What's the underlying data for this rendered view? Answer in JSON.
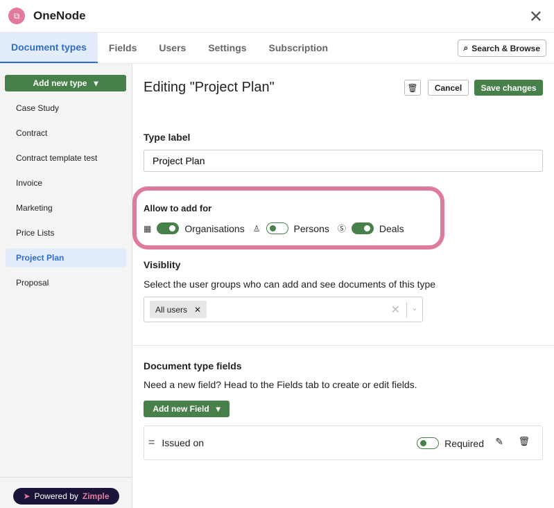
{
  "app": {
    "title": "OneNode",
    "logo_icon": "onenode-logo",
    "close_icon": "close-icon"
  },
  "tabs": [
    {
      "label": "Document types",
      "active": true
    },
    {
      "label": "Fields"
    },
    {
      "label": "Users"
    },
    {
      "label": "Settings"
    },
    {
      "label": "Subscription"
    }
  ],
  "search_button": "Search & Browse",
  "sidebar": {
    "add_label": "Add new type",
    "items": [
      "Case Study",
      "Contract",
      "Contract template test",
      "Invoice",
      "Marketing",
      "Price Lists",
      "Project Plan",
      "Proposal"
    ],
    "active": "Project Plan",
    "powered_prefix": "Powered by",
    "powered_brand": "Zimple"
  },
  "editor": {
    "title": "Editing \"Project Plan\"",
    "cancel": "Cancel",
    "save": "Save changes",
    "type_label": "Type label",
    "type_value": "Project Plan",
    "allow_label": "Allow to add for",
    "allow": [
      {
        "label": "Organisations",
        "on": true,
        "icon": "building-icon"
      },
      {
        "label": "Persons",
        "on": false,
        "icon": "person-icon"
      },
      {
        "label": "Deals",
        "on": true,
        "icon": "dollar-icon"
      }
    ],
    "visibility_label": "Visiblity",
    "visibility_desc": "Select the user groups who can add and see documents of this type",
    "visibility_chip": "All users",
    "fields_label": "Document type fields",
    "fields_desc": "Need a new field? Head to the Fields tab to create or edit fields.",
    "add_field": "Add new Field",
    "field": {
      "name": "Issued on",
      "required_label": "Required",
      "required": false
    }
  },
  "colors": {
    "accent": "#478049",
    "highlight": "#de7a9c",
    "tab_active": "#2f6dc6"
  }
}
